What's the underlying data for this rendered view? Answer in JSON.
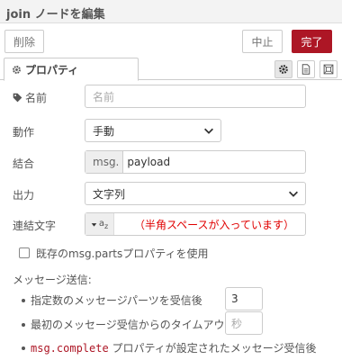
{
  "window": {
    "title": "join ノードを編集"
  },
  "toolbar": {
    "delete_label": "削除",
    "cancel_label": "中止",
    "done_label": "完了"
  },
  "tabs": {
    "properties_label": "プロパティ"
  },
  "form": {
    "name": {
      "label": "名前",
      "placeholder": "名前"
    },
    "mode": {
      "label": "動作",
      "value": "手動"
    },
    "combine": {
      "label": "結合",
      "prefix": "msg.",
      "value": "payload"
    },
    "output": {
      "label": "出力",
      "value": "文字列"
    },
    "joiner": {
      "label": "連結文字",
      "type_symbol": "a",
      "type_sub": "z",
      "note": "（半角スペースが入っています）"
    },
    "use_parts": {
      "label": "既存のmsg.partsプロパティを使用",
      "checked": false
    },
    "send": {
      "heading": "メッセージ送信:",
      "count_label": "指定数のメッセージパーツを受信後",
      "count_value": "3",
      "timeout_label": "最初のメッセージ受信からのタイムアウト後",
      "timeout_placeholder": "秒",
      "complete_code": "msg.complete",
      "complete_label": " プロパティが設定されたメッセージ受信後"
    }
  },
  "colors": {
    "accent": "#ad1625",
    "note": "#e00000"
  }
}
